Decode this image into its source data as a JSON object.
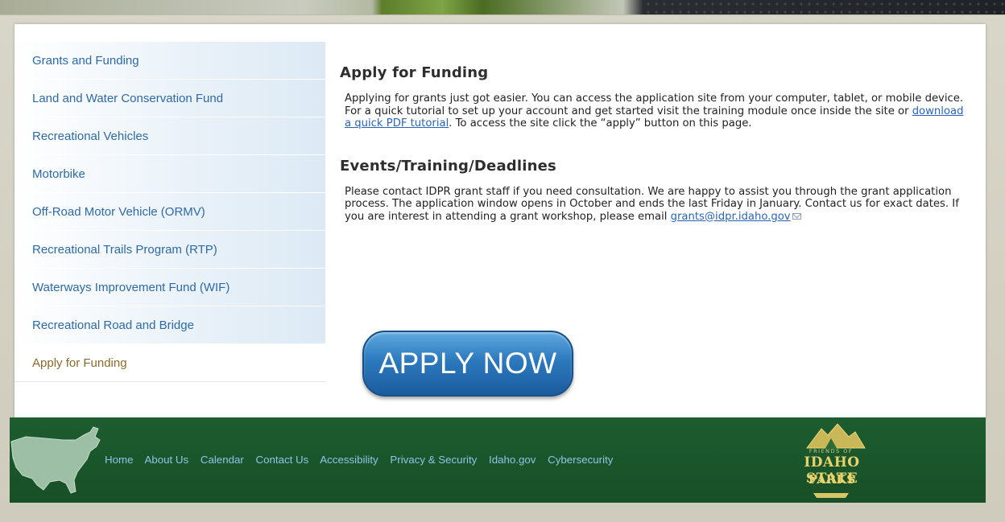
{
  "sidebar": {
    "items": [
      {
        "label": "Grants and Funding"
      },
      {
        "label": "Land and Water Conservation Fund"
      },
      {
        "label": "Recreational Vehicles"
      },
      {
        "label": "Motorbike"
      },
      {
        "label": "Off-Road Motor Vehicle (ORMV)"
      },
      {
        "label": "Recreational Trails Program (RTP)"
      },
      {
        "label": "Waterways Improvement Fund (WIF)"
      },
      {
        "label": "Recreational Road and Bridge"
      },
      {
        "label": "Apply for Funding"
      }
    ],
    "active_label": "Apply for Funding"
  },
  "main": {
    "heading1": "Apply for Funding",
    "para1_a": "Applying for grants just got easier. You can access the application site from your computer, tablet, or mobile device. For a quick tutorial to set up your account and get started visit the training module once inside the site or ",
    "para1_link": "download a quick PDF tutorial",
    "para1_b": ". To access the site click the “apply” button on this page.",
    "heading2": "Events/Training/Deadlines",
    "para2": "Please contact IDPR grant staff if you need consultation. We are happy to assist you through the grant application process. The application window opens in October and ends the last Friday in January. Contact us for exact dates. If you are interest in attending a grant workshop, please email ",
    "email": "grants@idpr.idaho.gov",
    "apply_button": "APPLY NOW"
  },
  "footer": {
    "links": [
      "Home",
      "About Us",
      "Calendar",
      "Contact Us",
      "Accessibility",
      "Privacy & Security",
      "Idaho.gov",
      "Cybersecurity"
    ],
    "logo_tag": "FRIENDS OF",
    "logo_line1": "IDAHO STATE",
    "logo_line2": "PARKS"
  },
  "colors": {
    "sidebar_link": "#2d6aa6",
    "sidebar_active": "#8a6a2a",
    "footer_bg": "#1d5d2f",
    "footer_link": "#8fc3e8",
    "button": "#2c79bd"
  },
  "icons": [
    "mail-icon",
    "us-map-icon",
    "idaho-state-parks-logo"
  ]
}
